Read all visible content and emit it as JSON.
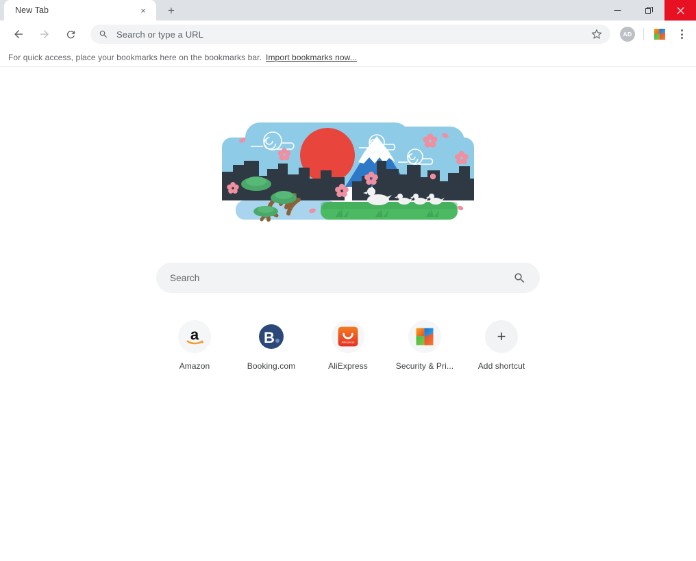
{
  "window": {
    "controls": {
      "minimize": "minimize-window",
      "maximize": "restore-window",
      "close": "close-window"
    },
    "close_color": "#e81123"
  },
  "tabstrip": {
    "tabs": [
      {
        "title": "New Tab",
        "close_label": "×"
      }
    ],
    "new_tab_label": "+"
  },
  "toolbar": {
    "back_label": "back-navigation",
    "forward_label": "forward-navigation",
    "reload_label": "reload-page",
    "omnibox": {
      "placeholder": "Search or type a URL",
      "value": ""
    },
    "bookmark_star": "bookmark-this-page",
    "avatar_initials": "AD",
    "extension_name": "security-extension",
    "menu_label": "chrome-menu"
  },
  "bookmarks_bar": {
    "message": "For quick access, place your bookmarks here on the bookmarks bar.",
    "import_link": "Import bookmarks now..."
  },
  "new_tab_page": {
    "doodle": {
      "name": "japan-mount-fuji-doodle",
      "colors": {
        "sky": "#8ecbe6",
        "sun": "#e8453c",
        "mountain": "#2d79c7",
        "snow": "#ffffff",
        "skyline": "#2f3944",
        "grass": "#4cb963",
        "water": "#a9d4ee",
        "blossom": "#f08fa0",
        "trunk": "#8b6239",
        "foliage": "#4aa86a"
      }
    },
    "search": {
      "placeholder": "Search",
      "value": "",
      "icon": "search-icon"
    },
    "shortcuts": [
      {
        "label": "Amazon",
        "icon": "amazon-icon",
        "icon_bg": "#f5f6f7"
      },
      {
        "label": "Booking.com",
        "icon": "booking-icon",
        "icon_bg": "#ffffff"
      },
      {
        "label": "AliExpress",
        "icon": "aliexpress-icon",
        "icon_bg": "#f5f6f7"
      },
      {
        "label": "Security & Pri...",
        "icon": "security-icon",
        "icon_bg": "#f5f6f7"
      },
      {
        "label": "Add shortcut",
        "icon": "plus-icon",
        "icon_bg": "#f1f3f4"
      }
    ]
  }
}
